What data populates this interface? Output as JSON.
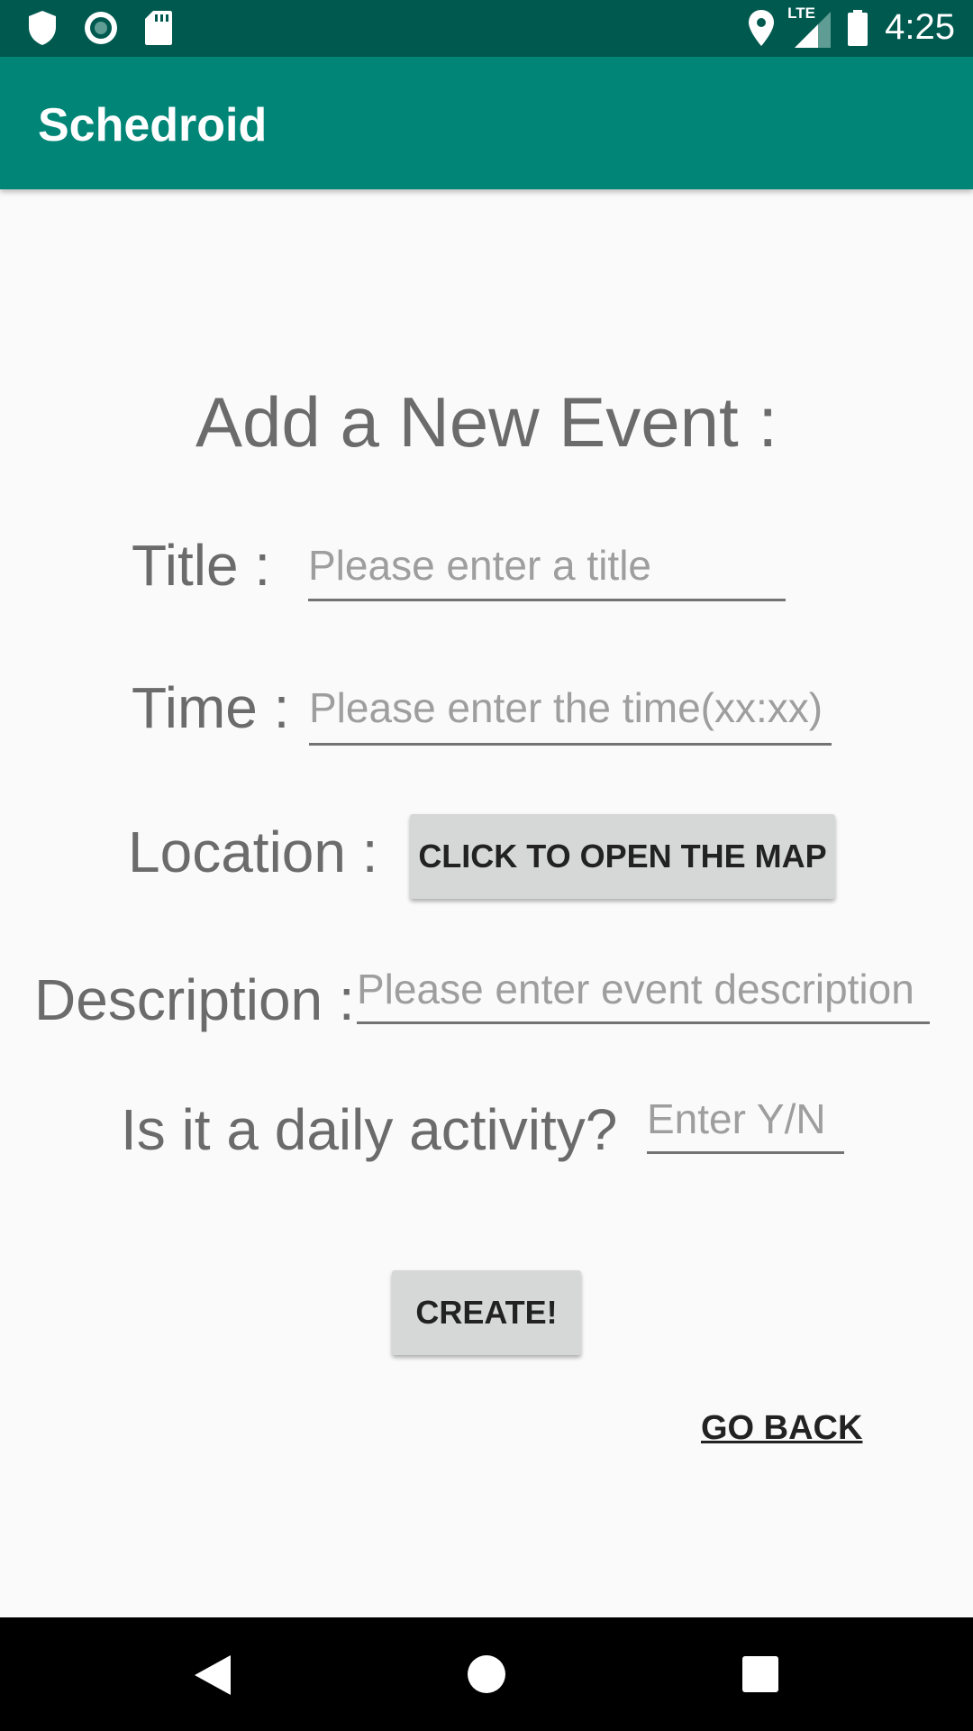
{
  "status_bar": {
    "time": "4:25",
    "network_label": "LTE",
    "icons": [
      "shield-icon",
      "record-icon",
      "sd-card-icon",
      "location-pin-icon",
      "lte-signal-icon",
      "battery-icon"
    ]
  },
  "app_bar": {
    "title": "Schedroid"
  },
  "form": {
    "heading": "Add a New Event :",
    "title_label": "Title :",
    "title_placeholder": "Please enter a title",
    "time_label": "Time :",
    "time_placeholder": "Please enter the time(xx:xx)",
    "location_label": "Location :",
    "map_button": "CLICK TO OPEN THE MAP",
    "description_label": "Description :",
    "description_placeholder": "Please enter event description",
    "daily_label": "Is it a daily activity?",
    "daily_placeholder": "Enter Y/N",
    "create_button": "CREATE!",
    "go_back": "GO BACK"
  },
  "nav_bar": {
    "icons": [
      "back-icon",
      "home-icon",
      "recents-icon"
    ]
  },
  "colors": {
    "primary": "#008577",
    "primary_dark": "#00594f",
    "background": "#fafafa",
    "label_text": "#6b6b6b",
    "hint_text": "#9e9e9e",
    "button_bg": "#d6d7d7"
  }
}
